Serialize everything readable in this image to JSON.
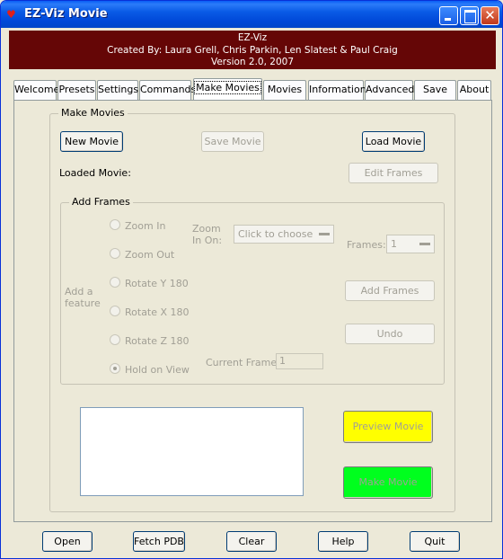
{
  "window": {
    "title": "EZ-Viz Movie",
    "icon_text": "♥"
  },
  "banner": {
    "line1": "EZ-Viz",
    "line2": "Created By: Laura Grell, Chris Parkin, Len Slatest & Paul Craig",
    "line3": "Version 2.0, 2007",
    "background": "#650606"
  },
  "tabs": [
    "Welcome",
    "Presets",
    "Settings",
    "Commands",
    "Make Movies",
    "Movies",
    "Information",
    "Advanced",
    "Save",
    "About"
  ],
  "active_tab": "Make Movies",
  "make_movies": {
    "group_label": "Make Movies",
    "new_movie": "New Movie",
    "save_movie": "Save Movie",
    "load_movie": "Load Movie",
    "loaded_movie_label": "Loaded Movie:",
    "edit_frames": "Edit Frames",
    "add_frames": {
      "group_label": "Add Frames",
      "add_feature_label": "Add a feature",
      "options": [
        "Zoom In",
        "Zoom Out",
        "Rotate Y 180",
        "Rotate X 180",
        "Rotate Z 180",
        "Hold on View"
      ],
      "selected_option": "Hold on View",
      "zoom_in_on_label": "Zoom In On:",
      "zoom_in_on_value": "Click to choose",
      "frames_label": "Frames:",
      "frames_value": "1",
      "add_frames_button": "Add Frames",
      "undo_button": "Undo",
      "current_frame_label": "Current Frame:",
      "current_frame_value": "1"
    },
    "preview_movie": "Preview Movie",
    "make_movie": "Make Movie",
    "preview_color": "#ffff00",
    "make_color": "#00ff1e"
  },
  "footer": {
    "open": "Open",
    "fetch_pdb": "Fetch PDB",
    "clear": "Clear",
    "help": "Help",
    "quit": "Quit"
  }
}
